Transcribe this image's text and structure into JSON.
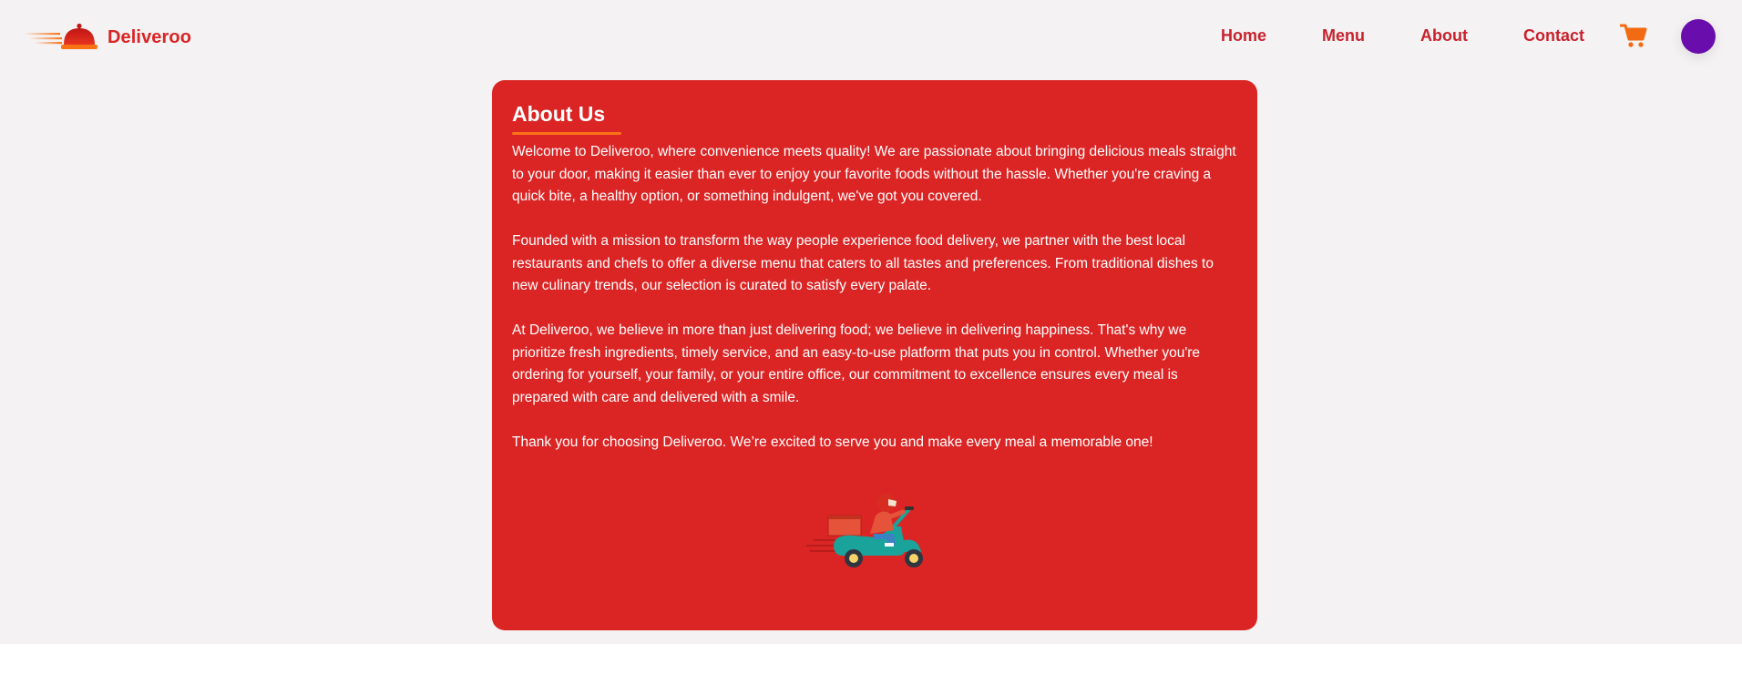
{
  "header": {
    "brand": "Deliveroo",
    "logo_icon": "food-cloche-icon",
    "nav": [
      {
        "label": "Home"
      },
      {
        "label": "Menu"
      },
      {
        "label": "About"
      },
      {
        "label": "Contact"
      }
    ],
    "cart_icon": "shopping-cart-icon",
    "avatar_color": "#6a0dad"
  },
  "about": {
    "title": "About Us",
    "paragraphs": [
      "Welcome to Deliveroo, where convenience meets quality! We are passionate about bringing delicious meals straight to your door, making it easier than ever to enjoy your favorite foods without the hassle. Whether you're craving a quick bite, a healthy option, or something indulgent, we've got you covered.",
      "Founded with a mission to transform the way people experience food delivery, we partner with the best local restaurants and chefs to offer a diverse menu that caters to all tastes and preferences. From traditional dishes to new culinary trends, our selection is curated to satisfy every palate.",
      "At Deliveroo, we believe in more than just delivering food; we believe in delivering happiness. That's why we prioritize fresh ingredients, timely service, and an easy-to-use platform that puts you in control. Whether you're ordering for yourself, your family, or your entire office, our commitment to excellence ensures every meal is prepared with care and delivered with a smile.",
      "Thank you for choosing Deliveroo. We’re excited to serve you and make every meal a memorable one!"
    ],
    "illustration": "delivery-scooter-illustration"
  },
  "colors": {
    "brand_red": "#d92525",
    "card_red": "#db2525",
    "accent_orange": "#f97316",
    "page_bg": "#f4f2f3"
  }
}
